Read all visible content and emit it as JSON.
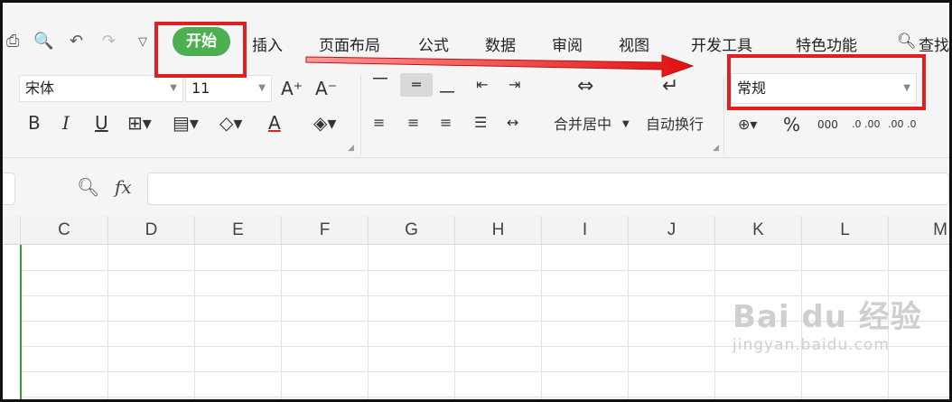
{
  "tabs": {
    "home": "开始",
    "items": [
      "插入",
      "页面布局",
      "公式",
      "数据",
      "审阅",
      "视图",
      "开发工具",
      "特色功能"
    ],
    "search": "查找"
  },
  "font": {
    "name": "宋体",
    "size": "11"
  },
  "format": {
    "value": "常规"
  },
  "ribbon": {
    "merge_center": "合并居中",
    "wrap_text": "自动换行",
    "bold": "B",
    "italic": "I",
    "underline": "U",
    "grow": "A⁺",
    "shrink": "A⁻",
    "font_color": "A",
    "percent": "%",
    "currency": "¥",
    "thousands": "000",
    "inc_decimal": ".0 .00",
    "dec_decimal": ".00 .0"
  },
  "formula_bar": {
    "fx": "fx",
    "value": ""
  },
  "columns": [
    "C",
    "D",
    "E",
    "F",
    "G",
    "H",
    "I",
    "J",
    "K",
    "L",
    "M"
  ],
  "watermark": {
    "main": "Bai du 经验",
    "sub": "jingyan.baidu.com"
  },
  "colors": {
    "accent": "#4caf50",
    "highlight": "#e02020",
    "selection": "#3a9a3a"
  }
}
